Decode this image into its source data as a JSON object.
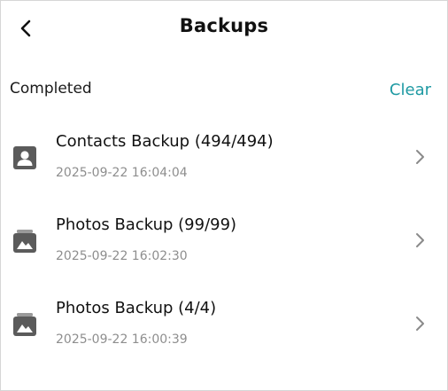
{
  "header": {
    "title": "Backups",
    "back_icon": "chevron-left-icon"
  },
  "section": {
    "label": "Completed",
    "clear_label": "Clear",
    "accent_color": "#1f9aa3"
  },
  "items": [
    {
      "title": "Contacts Backup (494/494)",
      "time": "2025-09-22 16:04:04",
      "icon": "contact-card-icon"
    },
    {
      "title": "Photos Backup (99/99)",
      "time": "2025-09-22 16:02:30",
      "icon": "photo-album-icon"
    },
    {
      "title": "Photos Backup (4/4)",
      "time": "2025-09-22 16:00:39",
      "icon": "photo-album-icon"
    }
  ]
}
